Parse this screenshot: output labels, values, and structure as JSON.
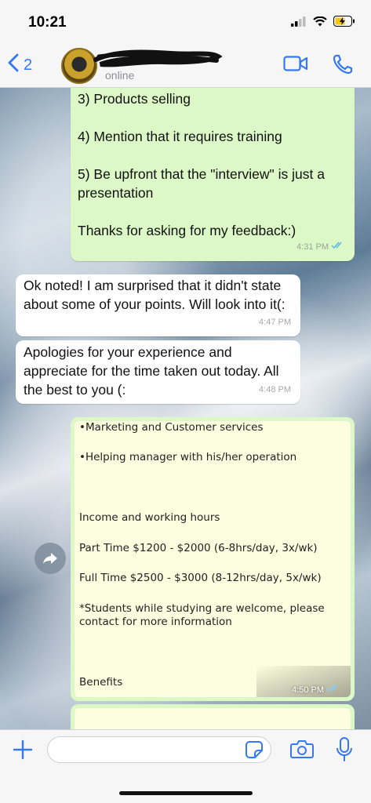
{
  "status": {
    "time": "10:21"
  },
  "header": {
    "back_count": "2",
    "contact_status": "online"
  },
  "messages": [
    {
      "text": "3) Products selling\n\n4) Mention that it requires training\n\n5) Be upfront that the \"interview\" is just a presentation\n\nThanks for asking for my feedback:)",
      "time": "4:31 PM"
    },
    {
      "text": "Ok noted! I am surprised that it didn't state about some of your points. Will look into it(:",
      "time": "4:47 PM"
    },
    {
      "text": "Apologies for your experience and appreciate for the time taken out today. All the best to you (:",
      "time": "4:48 PM"
    }
  ],
  "document": {
    "lines": [
      "•Marketing and Customer services",
      "•Helping manager with his/her operation",
      "Income and working hours",
      "Part Time $1200 - $2000 (6-8hrs/day, 3x/wk)",
      "Full Time $2500 - $3000 (8-12hrs/day, 5x/wk)",
      "*Students while studying are welcome, please\ncontact for more information",
      "Benefits"
    ],
    "time": "4:50 PM"
  },
  "input": {
    "placeholder": ""
  },
  "colors": {
    "accent": "#3478f6",
    "outgoing": "#dcf8c6",
    "incoming": "#ffffff",
    "read_tick": "#4fb6ec"
  }
}
